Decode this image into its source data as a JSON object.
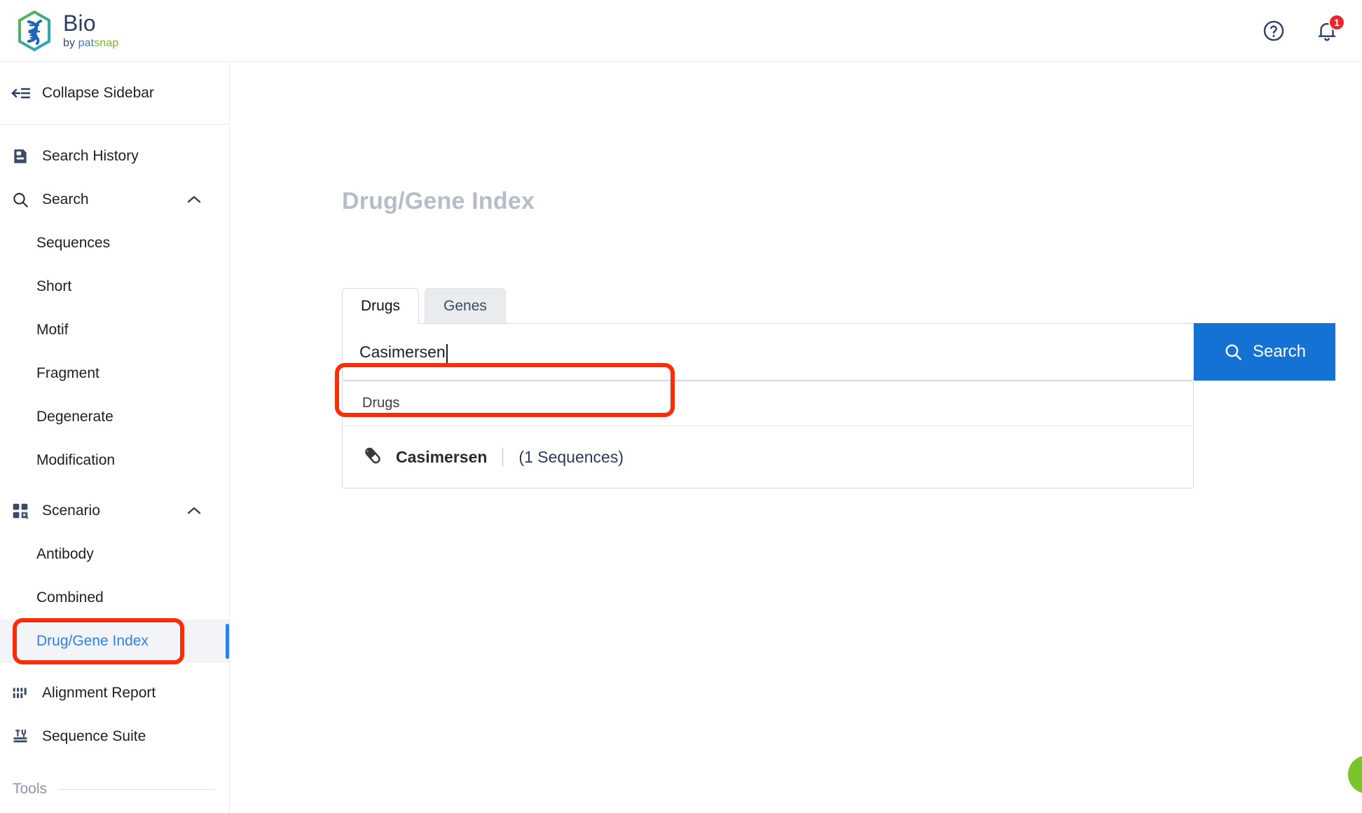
{
  "app": {
    "brand_name": "Bio",
    "brand_by": "by ",
    "brand_pat": "pat",
    "brand_snap": "snap",
    "logo_icon": "dna-hexagon-logo"
  },
  "topbar": {
    "help_icon": "help-circle-icon",
    "notifications_icon": "bell-icon",
    "notification_count": "1"
  },
  "sidebar": {
    "collapse_label": "Collapse Sidebar",
    "collapse_icon": "collapse-sidebar-icon",
    "items": [
      {
        "label": "Search History",
        "icon": "saved-search-icon",
        "type": "item"
      },
      {
        "label": "Search",
        "icon": "magnifier-icon",
        "type": "group",
        "chevron": "chevron-up-icon"
      },
      {
        "label": "Sequences",
        "type": "sub"
      },
      {
        "label": "Short",
        "type": "sub"
      },
      {
        "label": "Motif",
        "type": "sub"
      },
      {
        "label": "Fragment",
        "type": "sub"
      },
      {
        "label": "Degenerate",
        "type": "sub"
      },
      {
        "label": "Modification",
        "type": "sub"
      },
      {
        "label": "Scenario",
        "icon": "grid-search-icon",
        "type": "group",
        "chevron": "chevron-up-icon"
      },
      {
        "label": "Antibody",
        "type": "sub"
      },
      {
        "label": "Combined",
        "type": "sub"
      },
      {
        "label": "Drug/Gene Index",
        "type": "sub",
        "active": true
      },
      {
        "label": "Alignment Report",
        "icon": "alignment-bars-icon",
        "type": "item"
      },
      {
        "label": "Sequence Suite",
        "icon": "toolbox-icon",
        "type": "item"
      }
    ],
    "tools_label": "Tools"
  },
  "main": {
    "page_title": "Drug/Gene Index",
    "tabs": [
      {
        "label": "Drugs",
        "active": true
      },
      {
        "label": "Genes",
        "active": false
      }
    ],
    "search": {
      "value": "Casimersen",
      "placeholder": "",
      "button_label": "Search",
      "button_icon": "search-icon",
      "button_color": "#1372d4"
    },
    "suggestions": {
      "group_label": "Drugs",
      "items": [
        {
          "icon": "pill-capsule-icon",
          "name": "Casimersen",
          "separator": "|",
          "count_text": "(1 Sequences)"
        }
      ]
    }
  },
  "annotations": {
    "highlight_color": "#fb2d08",
    "boxes": [
      {
        "target": "sidebar-item-drug-gene-index"
      },
      {
        "target": "suggestion-item-casimersen"
      }
    ]
  }
}
